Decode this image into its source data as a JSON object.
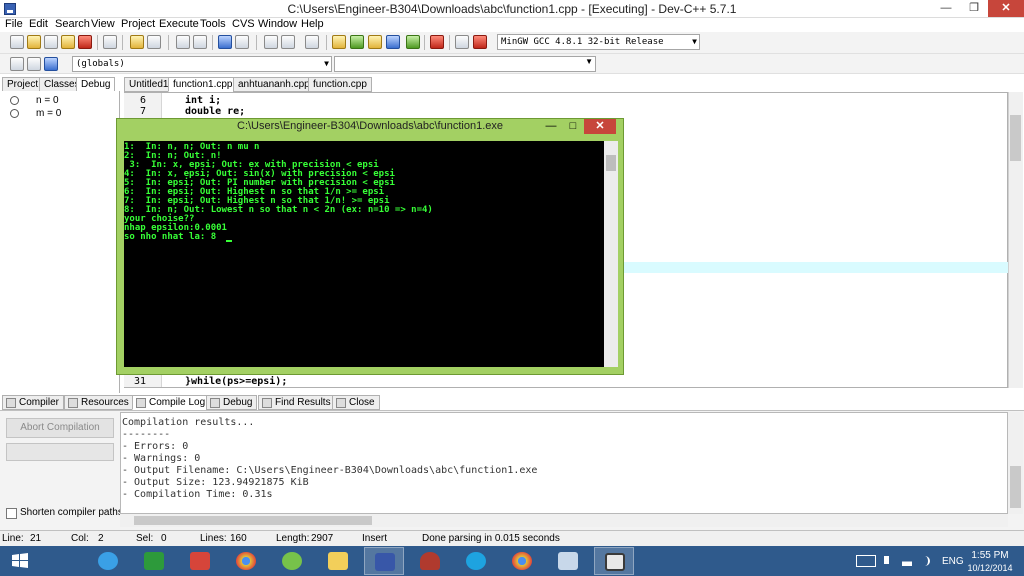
{
  "window": {
    "title": "C:\\Users\\Engineer-B304\\Downloads\\abc\\function1.cpp - [Executing] - Dev-C++ 5.7.1",
    "min_glyph": "—",
    "max_glyph": "❐",
    "close_glyph": "✕"
  },
  "menu": [
    "File",
    "Edit",
    "Search",
    "View",
    "Project",
    "Execute",
    "Tools",
    "CVS",
    "Window",
    "Help"
  ],
  "toolbar": {
    "compiler": "MinGW GCC 4.8.1 32-bit Release",
    "scope": "(globals)"
  },
  "left_panel": {
    "tabs": [
      "Project",
      "Classes",
      "Debug"
    ],
    "watches": [
      "n = 0",
      "m = 0"
    ]
  },
  "editor": {
    "tabs": [
      "Untitled1",
      "function1.cpp",
      "anhtuananh.cpp",
      "function.cpp"
    ],
    "lines": [
      {
        "num": "6",
        "code": "int i;"
      },
      {
        "num": "7",
        "code": "double re;"
      },
      {
        "num": "31",
        "code": "}while(ps>=epsi);"
      }
    ]
  },
  "console": {
    "title": "C:\\Users\\Engineer-B304\\Downloads\\abc\\function1.exe",
    "min_glyph": "—",
    "max_glyph": "□",
    "close_glyph": "✕",
    "lines": [
      "1:  In: n, n; Out: n mu n",
      "2:  In: n; Out: n!",
      " 3:  In: x, epsi; Out: ex with precision < epsi",
      "4:  In: x, epsi; Out: sin(x) with precision < epsi",
      "5:  In: epsi; Out: PI number with precision < epsi",
      "6:  In: epsi; Out: Highest n so that 1/n >= epsi",
      "7:  In: epsi; Out: Highest n so that 1/n! >= epsi",
      "8:  In: n; Out: Lowest n so that n < 2n (ex: n=10 => n=4)",
      "your choise??",
      "nhap epsilon:0.0001",
      "so nho nhat la: 8"
    ]
  },
  "bottom": {
    "tabs": [
      "Compiler",
      "Resources",
      "Compile Log",
      "Debug",
      "Find Results",
      "Close"
    ],
    "abort_label": "Abort Compilation",
    "shorten_label": "Shorten compiler paths",
    "log_lines": [
      "Compilation results...",
      "--------",
      "- Errors: 0",
      "- Warnings: 0",
      "- Output Filename: C:\\Users\\Engineer-B304\\Downloads\\abc\\function1.exe",
      "- Output Size: 123.94921875 KiB",
      "- Compilation Time: 0.31s"
    ]
  },
  "status": {
    "line_label": "Line:",
    "line": "21",
    "col_label": "Col:",
    "col": "2",
    "sel_label": "Sel:",
    "sel": "0",
    "lines_label": "Lines:",
    "lines": "160",
    "length_label": "Length:",
    "length": "2907",
    "mode": "Insert",
    "message": "Done parsing in 0.015 seconds"
  },
  "taskbar": {
    "language": "ENG",
    "time": "1:55 PM",
    "date": "10/12/2014"
  }
}
